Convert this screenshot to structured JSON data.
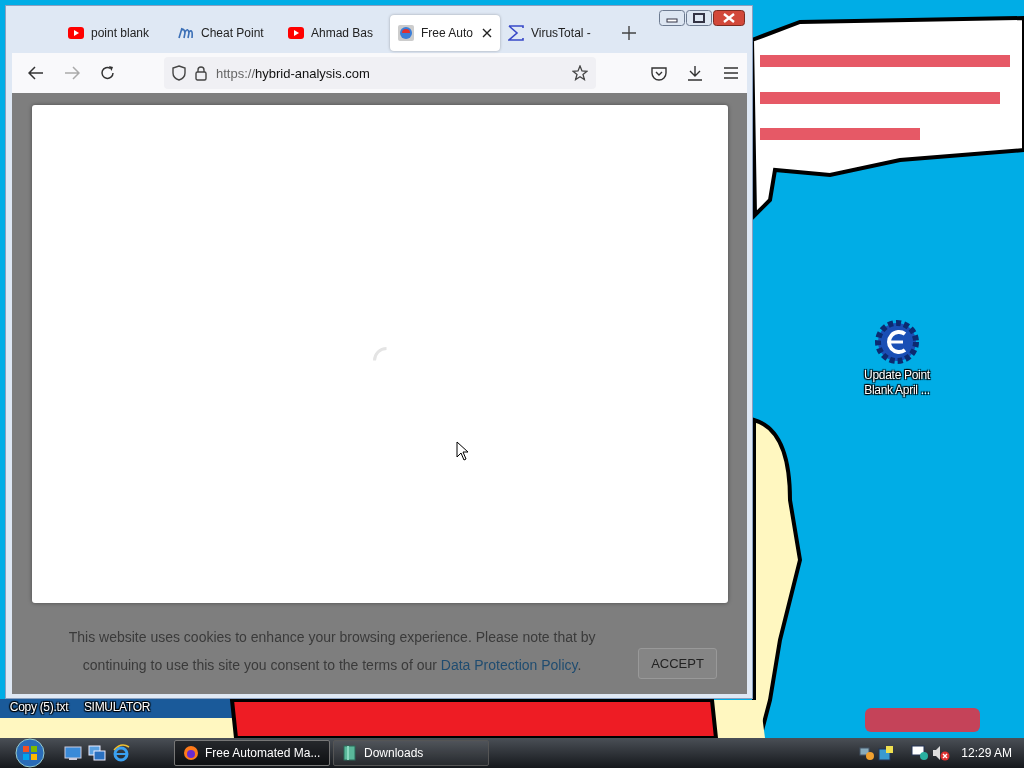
{
  "desktop": {
    "icons": [
      {
        "label": "Update Point Blank April ...",
        "kind": "gear"
      },
      {
        "label": "Copy (5).txt",
        "kind": "text"
      },
      {
        "label": "SIMULATOR",
        "kind": "text"
      }
    ]
  },
  "browser": {
    "tabs": [
      {
        "title": "point blank",
        "kind": "youtube",
        "selected": false
      },
      {
        "title": "Cheat Point",
        "kind": "script",
        "selected": false
      },
      {
        "title": "Ahmad Bas",
        "kind": "youtube",
        "selected": false
      },
      {
        "title": "Free Auto",
        "kind": "orb",
        "selected": true
      },
      {
        "title": "VirusTotal -",
        "kind": "sigma",
        "selected": false
      }
    ],
    "url_scheme": "https://",
    "url_host": "hybrid-analysis.com",
    "cookie_banner": {
      "text": "This website uses cookies to enhance your browsing experience. Please note that by continuing to use this site you consent to the terms of our ",
      "link": "Data Protection Policy",
      "text_end": ".",
      "button": "ACCEPT"
    }
  },
  "taskbar": {
    "tasks": [
      {
        "label": "Free Automated Ma...",
        "kind": "firefox",
        "selected": true
      },
      {
        "label": "Downloads",
        "kind": "folder",
        "selected": false
      }
    ],
    "clock": "12:29 AM"
  }
}
